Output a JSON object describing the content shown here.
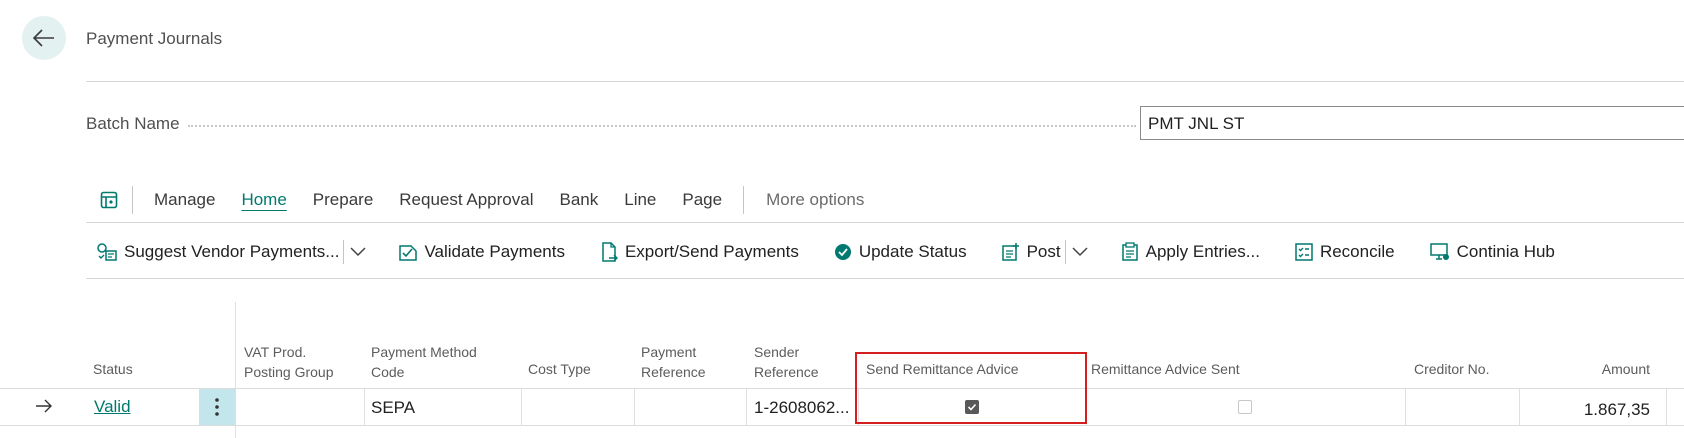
{
  "page": {
    "title": "Payment Journals"
  },
  "batch": {
    "label": "Batch Name",
    "value": "PMT JNL ST"
  },
  "action_tabs": [
    {
      "label": "Manage",
      "active": false
    },
    {
      "label": "Home",
      "active": true
    },
    {
      "label": "Prepare",
      "active": false
    },
    {
      "label": "Request Approval",
      "active": false
    },
    {
      "label": "Bank",
      "active": false
    },
    {
      "label": "Line",
      "active": false
    },
    {
      "label": "Page",
      "active": false
    }
  ],
  "more_options": "More options",
  "commands": {
    "suggest_vendor_payments": "Suggest Vendor Payments...",
    "validate_payments": "Validate Payments",
    "export_send_payments": "Export/Send Payments",
    "update_status": "Update Status",
    "post": "Post",
    "apply_entries": "Apply Entries...",
    "reconcile": "Reconcile",
    "continia_hub": "Continia Hub"
  },
  "columns": {
    "status": "Status",
    "vat_prod_line1": "VAT Prod.",
    "vat_prod_line2": "Posting Group",
    "pay_method_line1": "Payment Method",
    "pay_method_line2": "Code",
    "cost_type": "Cost Type",
    "pay_ref_line1": "Payment",
    "pay_ref_line2": "Reference",
    "sender_ref_line1": "Sender",
    "sender_ref_line2": "Reference",
    "send_remittance": "Send Remittance Advice",
    "remittance_sent": "Remittance Advice Sent",
    "creditor_no": "Creditor No.",
    "amount": "Amount"
  },
  "row": {
    "status": "Valid",
    "vat_prod": "",
    "payment_method": "SEPA",
    "cost_type": "",
    "payment_reference": "",
    "sender_reference": "1-2608062...",
    "send_remittance_advice": true,
    "remittance_advice_sent": false,
    "creditor_no": "",
    "amount": "1.867,35"
  },
  "colors": {
    "accent": "#00796f",
    "highlight": "#d41f1f",
    "selected_cell": "#c2e6ec"
  }
}
